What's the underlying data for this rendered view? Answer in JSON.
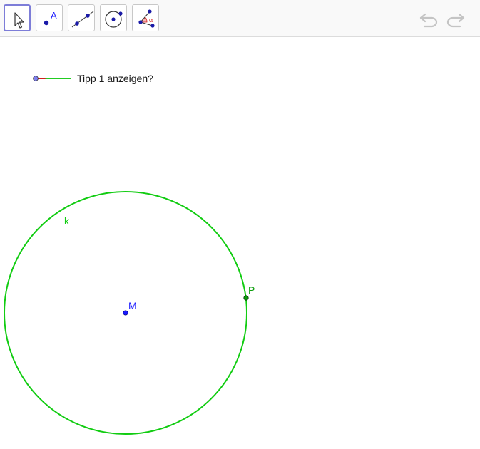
{
  "toolbar": {
    "tools": [
      {
        "name": "Move",
        "icon": "move-arrow-icon",
        "active": true
      },
      {
        "name": "Point",
        "icon": "point-icon",
        "label": "A"
      },
      {
        "name": "Line",
        "icon": "line-icon"
      },
      {
        "name": "Circle with Center through Point",
        "icon": "circle-icon"
      },
      {
        "name": "Angle",
        "icon": "angle-icon",
        "label": "α"
      }
    ],
    "undo_icon": "undo-icon",
    "redo_icon": "redo-icon"
  },
  "slider": {
    "label": "Tipp 1 anzeigen?",
    "value_fraction": 0.28,
    "colors": {
      "filled": "#d21f1f",
      "track": "#22cc22",
      "knob": "#7f7ff0"
    }
  },
  "construction": {
    "circle": {
      "name": "k",
      "color": "#11cc11"
    },
    "center": {
      "name": "M",
      "color": "#1a1aff"
    },
    "point_on_circle": {
      "name": "P",
      "color": "#0b9e0b"
    }
  }
}
